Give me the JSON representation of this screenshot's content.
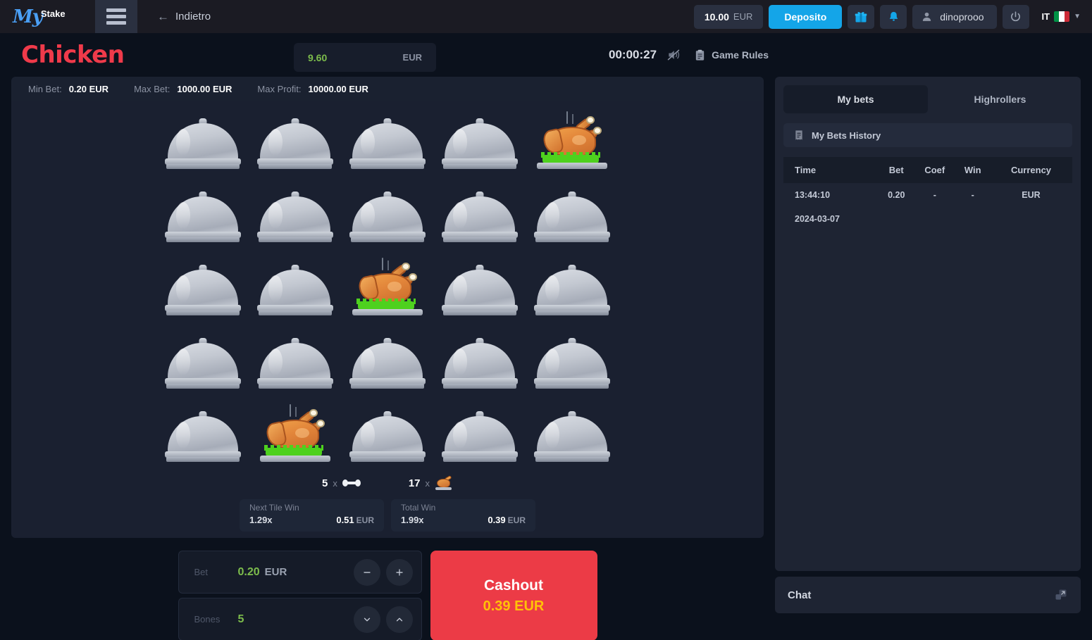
{
  "header": {
    "logo_my": "My",
    "logo_stake": "Stake",
    "menu_icon": "hamburger-menu-icon",
    "back_label": "Indietro",
    "back_icon": "arrow-left-icon",
    "balance_amount": "10.00",
    "balance_currency": "EUR",
    "deposit_label": "Deposito",
    "gift_icon": "gift-icon",
    "bell_icon": "bell-icon",
    "user_icon": "user-avatar-icon",
    "username": "dinoprooo",
    "power_icon": "power-icon",
    "language_code": "IT",
    "flag": "italy-flag-icon",
    "caret_icon": "chevron-down-icon",
    "accent_blue": "#14a5e8"
  },
  "game": {
    "title": "Chicken",
    "title_color": "#ef3a4a",
    "bet_display_value": "9.60",
    "bet_display_currency": "EUR",
    "timer": "00:00:27",
    "sound_icon": "sound-muted-icon",
    "rules_icon": "clipboard-icon",
    "rules_label": "Game Rules"
  },
  "limits": {
    "min_bet_label": "Min Bet:",
    "min_bet_value": "0.20 EUR",
    "max_bet_label": "Max Bet:",
    "max_bet_value": "1000.00 EUR",
    "max_profit_label": "Max Profit:",
    "max_profit_value": "10000.00 EUR"
  },
  "board": {
    "rows": 5,
    "cols": 5,
    "tiles": [
      [
        "cloche",
        "cloche",
        "cloche",
        "cloche",
        "chicken"
      ],
      [
        "cloche",
        "cloche",
        "cloche",
        "cloche",
        "cloche"
      ],
      [
        "cloche",
        "cloche",
        "chicken",
        "cloche",
        "cloche"
      ],
      [
        "cloche",
        "cloche",
        "cloche",
        "cloche",
        "cloche"
      ],
      [
        "cloche",
        "chicken",
        "cloche",
        "cloche",
        "cloche"
      ]
    ],
    "bones_count": "5",
    "bones_icon": "bone-icon",
    "chickens_count": "17",
    "chickens_icon": "chicken-icon",
    "multiply_symbol": "x"
  },
  "win_panels": [
    {
      "label": "Next Tile Win",
      "multiplier": "1.29x",
      "amount": "0.51",
      "currency": "EUR"
    },
    {
      "label": "Total Win",
      "multiplier": "1.99x",
      "amount": "0.39",
      "currency": "EUR"
    }
  ],
  "controls": {
    "bet_label": "Bet",
    "bet_value": "0.20",
    "bet_currency": "EUR",
    "minus_icon": "minus-icon",
    "plus_icon": "plus-icon",
    "bones_label": "Bones",
    "bones_value": "5",
    "bones_down_icon": "chevron-down-icon",
    "bones_up_icon": "chevron-up-icon",
    "cashout_label": "Cashout",
    "cashout_amount": "0.39",
    "cashout_currency": "EUR",
    "cashout_color": "#ec3b46"
  },
  "sidebar": {
    "tabs": [
      {
        "label": "My bets",
        "active": true
      },
      {
        "label": "Highrollers",
        "active": false
      }
    ],
    "history_header_icon": "receipt-icon",
    "history_header_label": "My Bets History",
    "table": {
      "columns": [
        "Time",
        "Bet",
        "Coef",
        "Win",
        "Currency"
      ],
      "rows": [
        {
          "time": "13:44:10",
          "bet": "0.20",
          "coef": "-",
          "win": "-",
          "currency": "EUR"
        }
      ],
      "date_group": "2024-03-07"
    }
  },
  "chat": {
    "label": "Chat",
    "expand_icon": "expand-icon"
  }
}
